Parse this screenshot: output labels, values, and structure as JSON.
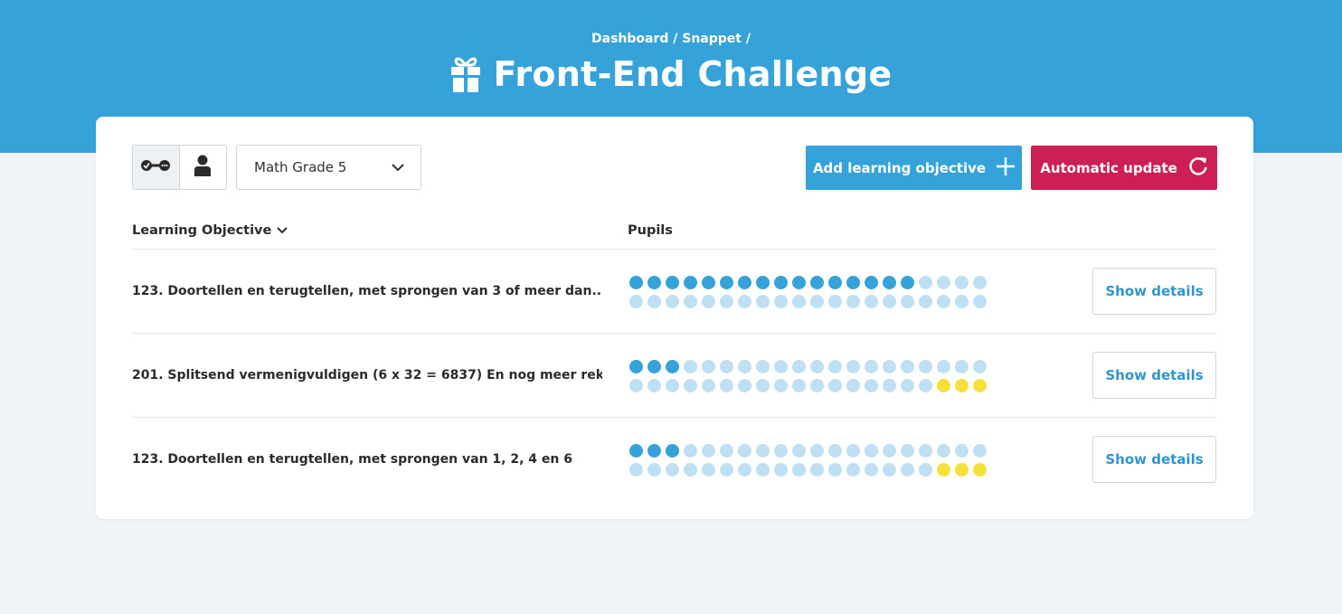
{
  "header": {
    "breadcrumb": "Dashboard / Snappet /",
    "title": "Front-End Challenge"
  },
  "toolbar": {
    "view_toggle": [
      "objectives-view-icon",
      "pupil-view-icon"
    ],
    "select": {
      "value": "Math Grade 5"
    },
    "add_label": "Add learning objective",
    "auto_label": "Automatic update"
  },
  "table": {
    "col_objective": "Learning Objective",
    "col_pupils": "Pupils",
    "details_label": "Show details",
    "rows": [
      {
        "objective": "123. Doortellen en terugtellen, met sprongen van 3 of meer dan...",
        "pupil_states": [
          "m",
          "m",
          "m",
          "m",
          "m",
          "m",
          "m",
          "m",
          "m",
          "m",
          "m",
          "m",
          "m",
          "m",
          "m",
          "m",
          "n",
          "n",
          "n",
          "n",
          "n",
          "n",
          "n",
          "n",
          "n",
          "n",
          "n",
          "n",
          "n",
          "n",
          "n",
          "n",
          "n",
          "n",
          "n",
          "n",
          "n",
          "n",
          "n",
          "n"
        ]
      },
      {
        "objective": "201. Splitsend vermenigvuldigen (6 x 32 = 6837) En nog meer rek...",
        "pupil_states": [
          "m",
          "m",
          "m",
          "n",
          "n",
          "n",
          "n",
          "n",
          "n",
          "n",
          "n",
          "n",
          "n",
          "n",
          "n",
          "n",
          "n",
          "n",
          "n",
          "n",
          "n",
          "n",
          "n",
          "n",
          "n",
          "n",
          "n",
          "n",
          "n",
          "n",
          "n",
          "n",
          "n",
          "n",
          "n",
          "n",
          "n",
          "a",
          "a",
          "a"
        ]
      },
      {
        "objective": "123. Doortellen en terugtellen, met sprongen van 1, 2, 4 en 6",
        "pupil_states": [
          "m",
          "m",
          "m",
          "n",
          "n",
          "n",
          "n",
          "n",
          "n",
          "n",
          "n",
          "n",
          "n",
          "n",
          "n",
          "n",
          "n",
          "n",
          "n",
          "n",
          "n",
          "n",
          "n",
          "n",
          "n",
          "n",
          "n",
          "n",
          "n",
          "n",
          "n",
          "n",
          "n",
          "n",
          "n",
          "n",
          "n",
          "a",
          "a",
          "a"
        ]
      }
    ]
  },
  "colors": {
    "brand_blue": "#35a2d9",
    "accent_red": "#cc1f53",
    "not_mastered": "#bfe0f3",
    "attention_yellow": "#f5e13a"
  }
}
